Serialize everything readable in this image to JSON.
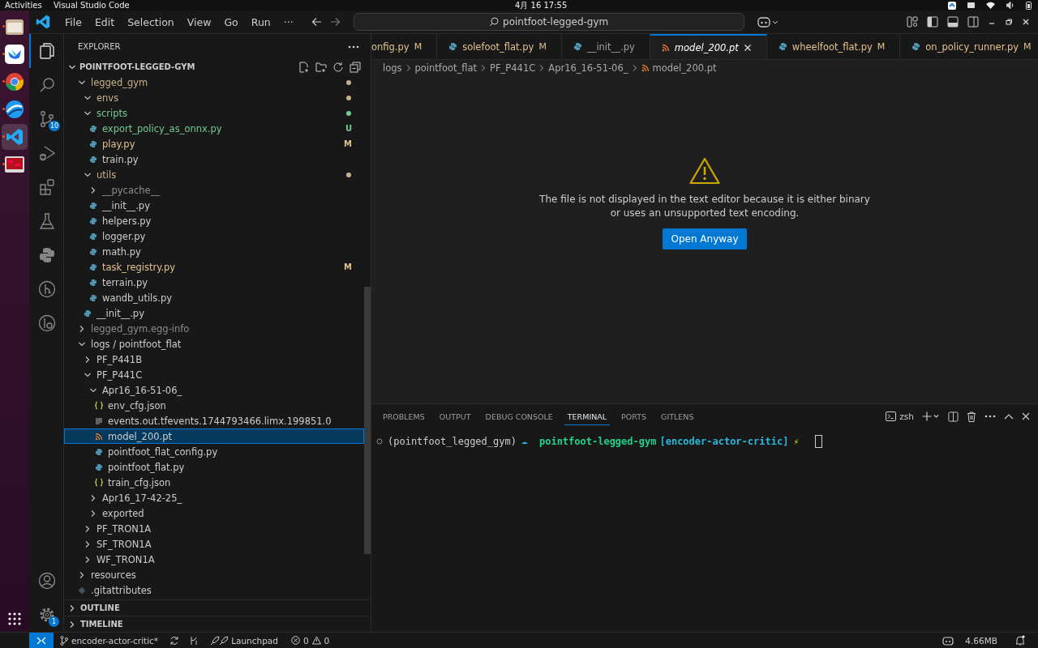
{
  "top_bar": {
    "activities": "Activities",
    "app": "Visual Studio Code",
    "clock": "4月 16  17:55"
  },
  "dock": {
    "items": [
      {
        "kind": "files",
        "selected": false,
        "running": true
      },
      {
        "kind": "bird",
        "selected": false,
        "running": true
      },
      {
        "kind": "browser",
        "selected": false,
        "running": true
      },
      {
        "kind": "sphere",
        "selected": false,
        "running": true
      },
      {
        "kind": "code",
        "selected": true,
        "running": true
      },
      {
        "kind": "monitor",
        "selected": false,
        "running": true
      }
    ]
  },
  "title_bar": {
    "menu": [
      "File",
      "Edit",
      "Selection",
      "View",
      "Go",
      "Run",
      "···"
    ],
    "search": "pointfoot-legged-gym"
  },
  "activity_bar": {
    "items": [
      {
        "kind": "explorer",
        "selected": true
      },
      {
        "kind": "search",
        "selected": false
      },
      {
        "kind": "source_control",
        "selected": false,
        "badge": "10"
      },
      {
        "kind": "run",
        "selected": false
      },
      {
        "kind": "extensions",
        "selected": false
      },
      {
        "kind": "testing",
        "selected": false
      },
      {
        "kind": "python",
        "selected": false
      },
      {
        "kind": "graph",
        "selected": false
      },
      {
        "kind": "inspect",
        "selected": false
      }
    ],
    "bottom": [
      {
        "kind": "account"
      },
      {
        "kind": "settings",
        "badge": "1"
      }
    ]
  },
  "sidebar": {
    "title": "EXPLORER",
    "root": "POINTFOOT-LEGGED-GYM",
    "tree": [
      {
        "name": "legged_gym",
        "kind": "folder",
        "expanded": true,
        "changed": true,
        "color": "#c8b08a",
        "selected": false,
        "children": [
          {
            "name": "envs",
            "kind": "folder",
            "expanded": true,
            "changed": true,
            "color": "#c8b08a",
            "selected": false
          },
          {
            "name": "scripts",
            "kind": "folder",
            "expanded": true,
            "changed": true,
            "color": "#73c991",
            "selected": false,
            "children": [
              {
                "name": "export_policy_as_onnx.py",
                "kind": "python",
                "status": "U",
                "color": "#73c991",
                "selected": false
              },
              {
                "name": "play.py",
                "kind": "python",
                "status": "M",
                "color": "#e2c08d",
                "selected": false
              },
              {
                "name": "train.py",
                "kind": "python",
                "selected": false
              }
            ]
          },
          {
            "name": "utils",
            "kind": "folder",
            "expanded": true,
            "changed": true,
            "color": "#c8b08a",
            "selected": false,
            "children": [
              {
                "name": "__pycache__",
                "kind": "folder",
                "expanded": false,
                "color": "#8c8c8c",
                "selected": false
              },
              {
                "name": "__init__.py",
                "kind": "python",
                "selected": false
              },
              {
                "name": "helpers.py",
                "kind": "python",
                "selected": false
              },
              {
                "name": "logger.py",
                "kind": "python",
                "selected": false
              },
              {
                "name": "math.py",
                "kind": "python",
                "selected": false
              },
              {
                "name": "task_registry.py",
                "kind": "python",
                "status": "M",
                "color": "#e2c08d",
                "selected": false
              },
              {
                "name": "terrain.py",
                "kind": "python",
                "selected": false
              },
              {
                "name": "wandb_utils.py",
                "kind": "python",
                "selected": false
              }
            ]
          },
          {
            "name": "__init__.py",
            "kind": "python",
            "selected": false
          }
        ]
      },
      {
        "name": "legged_gym.egg-info",
        "kind": "folder",
        "expanded": false,
        "color": "#8c8c8c",
        "selected": false
      },
      {
        "name": "logs / pointfoot_flat",
        "kind": "folder",
        "expanded": true,
        "selected": false,
        "children": [
          {
            "name": "PF_P441B",
            "kind": "folder",
            "expanded": false,
            "selected": false
          },
          {
            "name": "PF_P441C",
            "kind": "folder",
            "expanded": true,
            "selected": false,
            "children": [
              {
                "name": "Apr16_16-51-06_",
                "kind": "folder",
                "expanded": true,
                "selected": false,
                "children": [
                  {
                    "name": "env_cfg.json",
                    "kind": "json",
                    "selected": false
                  },
                  {
                    "name": "events.out.tfevents.1744793466.limx.199851.0",
                    "kind": "text",
                    "selected": false
                  },
                  {
                    "name": "model_200.pt",
                    "kind": "rss",
                    "selected": true
                  },
                  {
                    "name": "pointfoot_flat_config.py",
                    "kind": "python",
                    "selected": false
                  },
                  {
                    "name": "pointfoot_flat.py",
                    "kind": "python",
                    "selected": false
                  },
                  {
                    "name": "train_cfg.json",
                    "kind": "json",
                    "selected": false
                  }
                ]
              },
              {
                "name": "Apr16_17-42-25_",
                "kind": "folder",
                "expanded": false,
                "selected": false
              },
              {
                "name": "exported",
                "kind": "folder",
                "expanded": false,
                "selected": false
              }
            ]
          },
          {
            "name": "PF_TRON1A",
            "kind": "folder",
            "expanded": false,
            "selected": false
          },
          {
            "name": "SF_TRON1A",
            "kind": "folder",
            "expanded": false,
            "selected": false
          },
          {
            "name": "WF_TRON1A",
            "kind": "folder",
            "expanded": false,
            "selected": false
          }
        ]
      },
      {
        "name": "resources",
        "kind": "folder",
        "expanded": false,
        "selected": false
      },
      {
        "name": ".gitattributes",
        "kind": "git",
        "selected": false
      }
    ],
    "sections": [
      "OUTLINE",
      "TIMELINE"
    ]
  },
  "editor": {
    "tabs": [
      {
        "label": "onfig.py",
        "mark": "M",
        "preview": false,
        "selected": false
      },
      {
        "label": "solefoot_flat.py",
        "kind": "python",
        "mark": "M",
        "preview": false,
        "selected": false
      },
      {
        "label": "__init__.py",
        "kind": "python",
        "preview": false,
        "selected": false
      },
      {
        "label": "model_200.pt",
        "kind": "rss",
        "preview": true,
        "selected": true
      },
      {
        "label": "wheelfoot_flat.py",
        "kind": "python",
        "mark": "M",
        "preview": false,
        "selected": false
      },
      {
        "label": "on_policy_runner.py",
        "kind": "python",
        "mark": "M",
        "preview": false,
        "selected": false
      }
    ],
    "breadcrumbs": [
      "logs",
      "pointfoot_flat",
      "PF_P441C",
      "Apr16_16-51-06_",
      "model_200.pt"
    ],
    "message": "The file is not displayed in the text editor because it is either binary or uses an unsupported text encoding.",
    "button": "Open Anyway"
  },
  "panel": {
    "tabs": [
      {
        "label": "PROBLEMS",
        "selected": false
      },
      {
        "label": "OUTPUT",
        "selected": false
      },
      {
        "label": "DEBUG CONSOLE",
        "selected": false
      },
      {
        "label": "TERMINAL",
        "selected": true
      },
      {
        "label": "PORTS",
        "selected": false
      },
      {
        "label": "GITLENS",
        "selected": false
      }
    ],
    "shell": "zsh",
    "terminal": {
      "env": "(pointfoot_legged_gym)",
      "dir": "pointfoot-legged-gym",
      "branch": "[encoder-actor-critic]",
      "flag": "⚡"
    }
  },
  "status_bar": {
    "branch": "encoder-actor-critic*",
    "launchpad": "Launchpad",
    "errors": "0",
    "warnings": "0",
    "memory": "4.66MB"
  }
}
